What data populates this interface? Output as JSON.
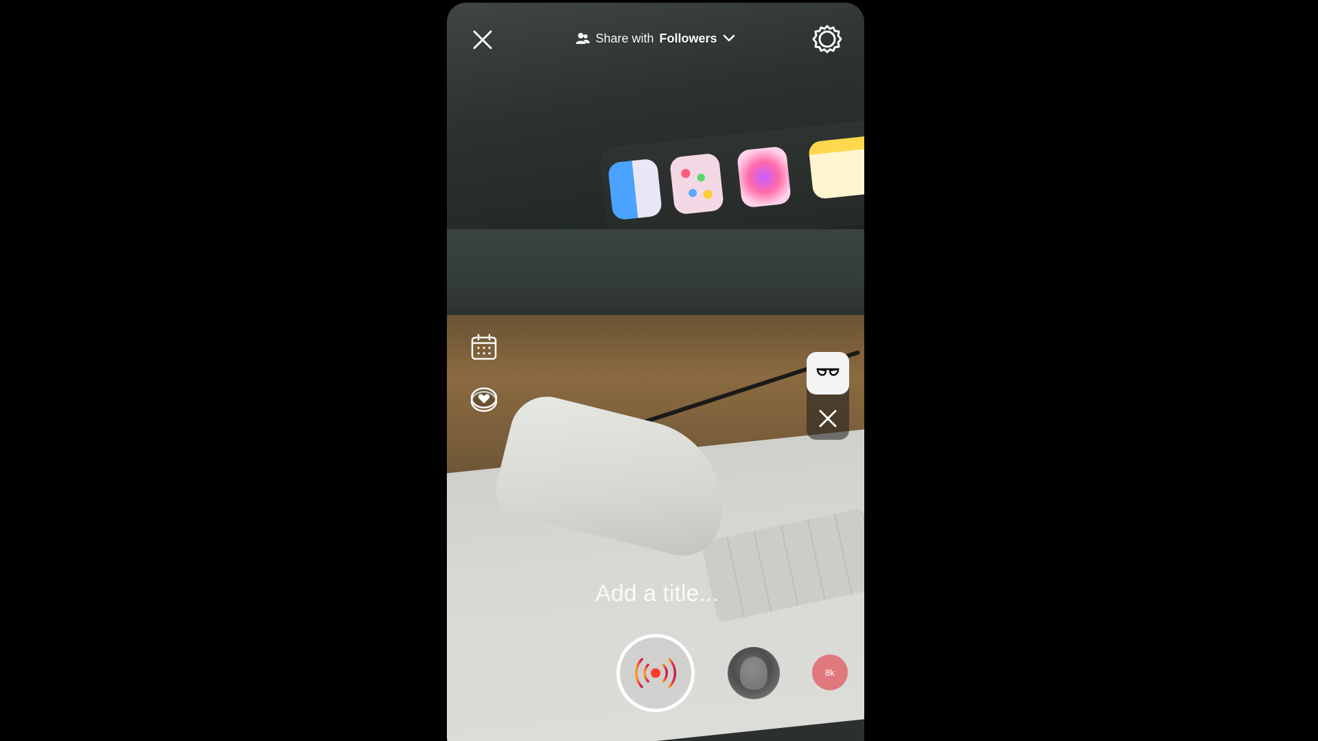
{
  "header": {
    "share_prefix": "Share with",
    "share_audience": "Followers"
  },
  "title_field": {
    "placeholder": "Add a title..."
  },
  "badge": {
    "label": "8k"
  },
  "icons": {
    "close": "close-icon",
    "settings": "gear-icon",
    "audience": "people-icon",
    "dropdown": "chevron-down-icon",
    "schedule": "calendar-icon",
    "fundraiser": "heart-coin-icon",
    "effect": "glasses-icon",
    "effect_remove": "close-icon",
    "go_live": "broadcast-icon"
  },
  "colors": {
    "live_accent": "#ff3b30",
    "badge_bg": "#e0787d"
  }
}
